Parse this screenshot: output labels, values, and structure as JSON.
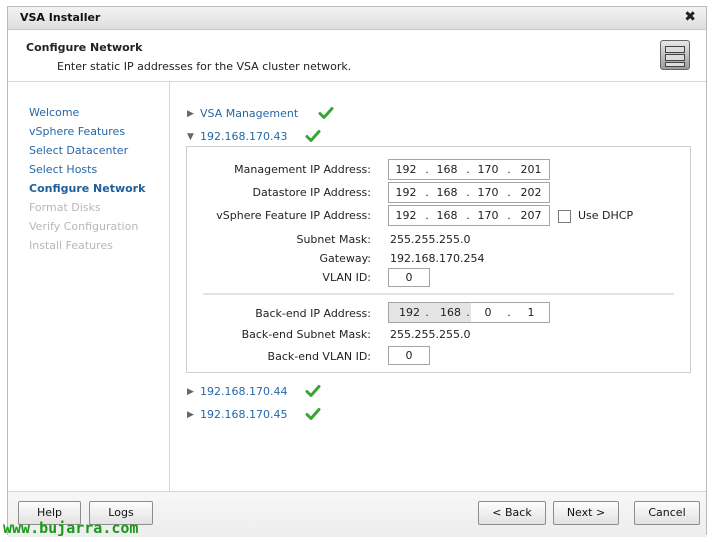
{
  "window": {
    "title": "VSA Installer",
    "close_glyph": "✖"
  },
  "header": {
    "title": "Configure Network",
    "subtitle": "Enter static IP addresses for the VSA cluster network.",
    "icon": "server-rack-icon"
  },
  "nav": {
    "items": [
      {
        "label": "Welcome",
        "state": "link"
      },
      {
        "label": "vSphere Features",
        "state": "link"
      },
      {
        "label": "Select Datacenter",
        "state": "link"
      },
      {
        "label": "Select Hosts",
        "state": "link"
      },
      {
        "label": "Configure Network",
        "state": "active"
      },
      {
        "label": "Format Disks",
        "state": "disabled"
      },
      {
        "label": "Verify Configuration",
        "state": "disabled"
      },
      {
        "label": "Install Features",
        "state": "disabled"
      }
    ]
  },
  "tree": {
    "vsa_management": {
      "label": "VSA Management",
      "expanded": false
    },
    "host1": {
      "label": "192.168.170.43",
      "expanded": true
    },
    "host2": {
      "label": "192.168.170.44",
      "expanded": false
    },
    "host3": {
      "label": "192.168.170.45",
      "expanded": false
    },
    "check_color": "#3aa536"
  },
  "form": {
    "mgmt_ip": {
      "label": "Management IP Address:",
      "octets": [
        "192",
        "168",
        "170",
        "201"
      ]
    },
    "ds_ip": {
      "label": "Datastore IP Address:",
      "octets": [
        "192",
        "168",
        "170",
        "202"
      ]
    },
    "vs_ip": {
      "label": "vSphere Feature IP Address:",
      "octets": [
        "192",
        "168",
        "170",
        "207"
      ]
    },
    "use_dhcp": {
      "label": "Use DHCP",
      "checked": false
    },
    "subnet": {
      "label": "Subnet Mask:",
      "value": "255.255.255.0"
    },
    "gateway": {
      "label": "Gateway:",
      "value": "192.168.170.254"
    },
    "vlan": {
      "label": "VLAN ID:",
      "value": "0"
    },
    "be_ip": {
      "label": "Back-end IP Address:",
      "octets": [
        "192",
        "168",
        "0",
        "1"
      ]
    },
    "be_subnet": {
      "label": "Back-end Subnet Mask:",
      "value": "255.255.255.0"
    },
    "be_vlan": {
      "label": "Back-end VLAN ID:",
      "value": "0"
    }
  },
  "footer": {
    "help": "Help",
    "logs": "Logs",
    "back": "< Back",
    "next": "Next >",
    "cancel": "Cancel"
  },
  "watermark": "www.bujarra.com"
}
